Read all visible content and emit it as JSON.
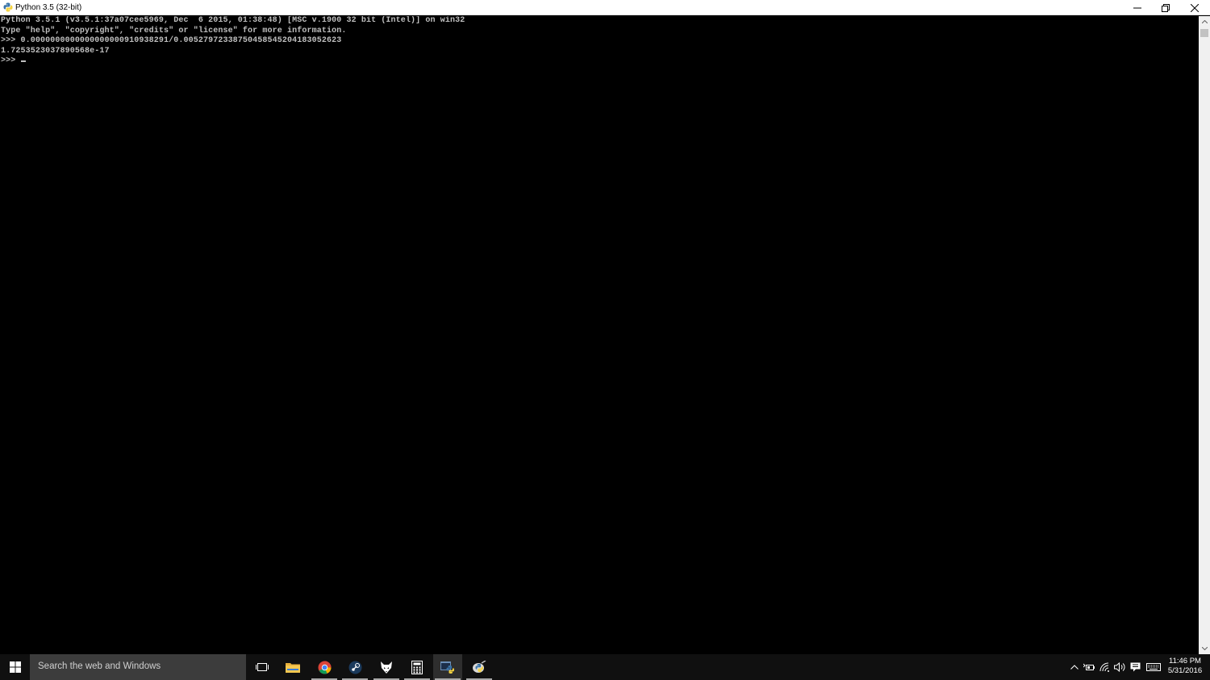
{
  "window": {
    "title": "Python 3.5 (32-bit)"
  },
  "console": {
    "lines": [
      "Python 3.5.1 (v3.5.1:37a07cee5969, Dec  6 2015, 01:38:48) [MSC v.1900 32 bit (Intel)] on win32",
      "Type \"help\", \"copyright\", \"credits\" or \"license\" for more information.",
      ">>> 0.0000000000000000000910938291/0.005279723387504585452041830526​23",
      "1.7253523037890568e-17"
    ],
    "prompt": ">>> "
  },
  "taskbar": {
    "search_placeholder": "Search the web and Windows",
    "apps": [
      {
        "name": "task-view",
        "icon": "task-view-icon"
      },
      {
        "name": "file-explorer",
        "icon": "folder-icon"
      },
      {
        "name": "chrome",
        "icon": "chrome-icon"
      },
      {
        "name": "steam",
        "icon": "steam-icon"
      },
      {
        "name": "fox-app",
        "icon": "fox-icon"
      },
      {
        "name": "calculator",
        "icon": "calculator-icon"
      },
      {
        "name": "python",
        "icon": "python-icon"
      },
      {
        "name": "idle",
        "icon": "idle-icon"
      }
    ],
    "clock": {
      "time": "11:46 PM",
      "date": "5/31/2016"
    }
  },
  "colors": {
    "console_bg": "#000000",
    "console_text": "#c0c0c0",
    "taskbar_bg": "#101010",
    "search_bg": "#3c3c3c"
  }
}
